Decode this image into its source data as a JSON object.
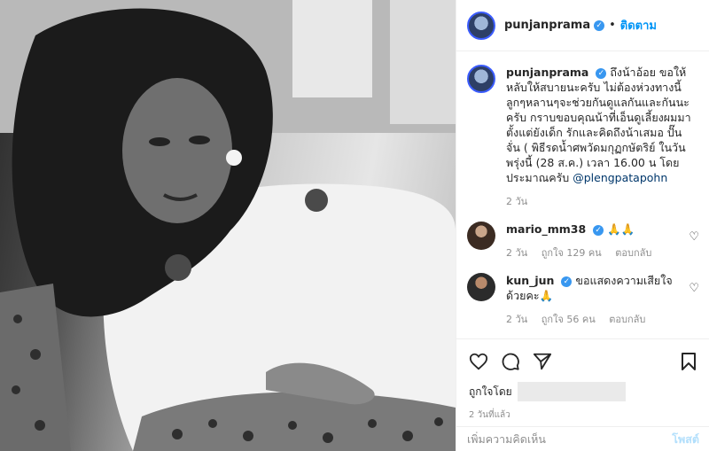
{
  "header": {
    "username": "punjanprama",
    "dot": "•",
    "follow_label": "ติดตาม"
  },
  "caption": {
    "username": "punjanprama",
    "text": "ถึงน้าอ้อย ขอให้หลับให้สบายนะครับ ไม่ต้องห่วงทางนี้ ลูกๆหลานๆจะช่วยกันดูแลกันและกันนะครับ กราบขอบคุณน้าที่เอ็นดูเลี้ยงผมมาตั้งแต่ยังเด็ก รักและคิดถึงน้าเสมอ ปั๊นจั่น ( พิธีรดน้ำศพวัดมกุฏกษัตริย์ ในวันพรุ่งนี้ (28 ส.ค.) เวลา 16.00 น โดยประมาณครับ",
    "mention": "@plengpatapohn",
    "time": "2 วัน"
  },
  "comments": [
    {
      "username": "mario_mm38",
      "text": "🙏🙏",
      "time": "2 วัน",
      "likes": "ถูกใจ 129 คน",
      "reply": "ตอบกลับ"
    },
    {
      "username": "kun_jun",
      "text": "ขอแสดงความเสียใจด้วยคะ🙏",
      "time": "2 วัน",
      "likes": "ถูกใจ 56 คน",
      "reply": "ตอบกลับ"
    }
  ],
  "actions": {
    "liked_by": "ถูกใจโดย",
    "posted_time": "2 วันที่แล้ว",
    "comment_placeholder": "เพิ่มความคิดเห็น",
    "post_label": "โพสต์"
  },
  "icons": {
    "verified": "✓",
    "heart_small": "♡"
  },
  "colors": {
    "accent": "#0095f6",
    "verified": "#3897f0",
    "post_disabled": "#b2dffc"
  }
}
